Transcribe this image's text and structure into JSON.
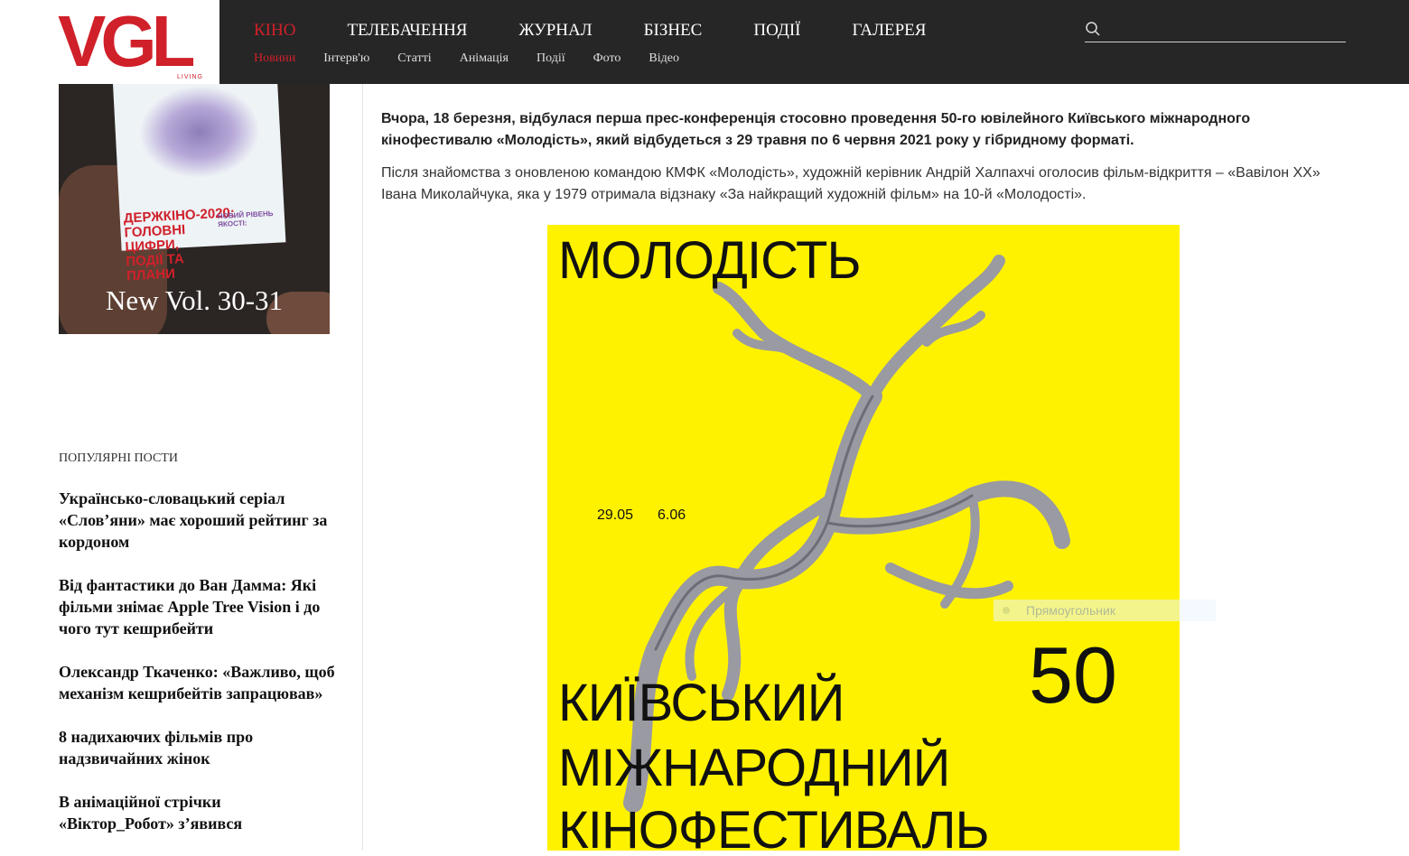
{
  "logo": {
    "text": "VGL",
    "subtext": "LIVING"
  },
  "nav": {
    "main": [
      "КІНО",
      "ТЕЛЕБАЧЕННЯ",
      "ЖУРНАЛ",
      "БІЗНЕС",
      "ПОДІЇ",
      "ГАЛЕРЕЯ"
    ],
    "sub": [
      "Новини",
      "Інтерв'ю",
      "Статті",
      "Анімація",
      "Події",
      "Фото",
      "Відео"
    ],
    "active_color": "#d0202a"
  },
  "search": {
    "placeholder": "",
    "icon": "search-icon"
  },
  "magazine": {
    "cover_title": "ДЕРЖКІНО-2020: ГОЛОВНІ ЦИФРИ, ПОДІЇ ТА ПЛАНИ",
    "cover_side": "НОВИЙ РІВЕНЬ ЯКОСТІ:",
    "volume": "New Vol. 30-31"
  },
  "popular": {
    "title": "ПОПУЛЯРНІ ПОСТИ",
    "posts": [
      "Українсько-словацький серіал «Слов’яни» має хороший рейтинг за кордоном",
      "Від фантастики до Ван Дамма: Які фільми знімає Apple Tree Vision і до чого тут кешрибейти",
      "Олександр Ткаченко: «Важливо, щоб механізм кешрибейтів запрацював»",
      "8 надихаючих фільмів про надзвичайних жінок",
      "В анімаційної стрічки «Віктор_Робот» з’явився"
    ]
  },
  "article": {
    "lead": "Вчора, 18 березня, відбулася перша прес-конференція стосовно проведення 50-го ювілейного Київського міжнародного кінофестивалю «Молодість», який відбудеться з 29 травня по 6 червня 2021 року у гібридному форматі.",
    "paragraph": "Після знайомства з оновленою командою КМФК «Молодість», художній керівник Андрій Халпахчі оголосив фільм-відкриття – «Вавілон XX» Івана Миколайчука, яка у 1979 отримала відзнаку «За найкращий художній фільм» на 10-й «Молодості»."
  },
  "poster": {
    "title": "МОЛОДІСТЬ",
    "date_start": "29.05",
    "date_end": "6.06",
    "number": "50",
    "line1": "КИЇВСЬКИЙ",
    "line2": "МІЖНАРОДНИЙ",
    "line3": "КІНОФЕСТИВАЛЬ",
    "background": "#fff200"
  },
  "tooltip": {
    "label": "Прямоугольник"
  }
}
